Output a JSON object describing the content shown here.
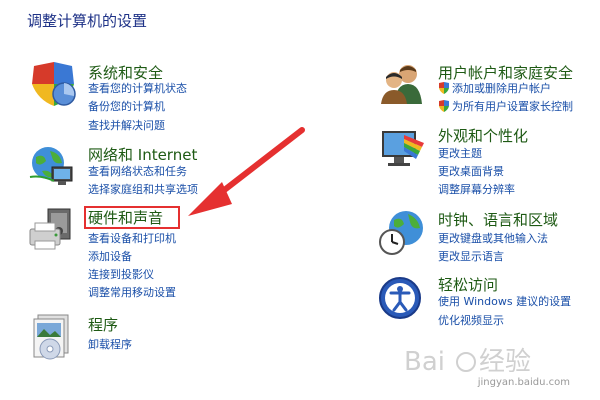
{
  "page": {
    "title": "调整计算机的设置"
  },
  "categories": {
    "system_security": {
      "heading": "系统和安全",
      "links": [
        "查看您的计算机状态",
        "备份您的计算机",
        "查找并解决问题"
      ]
    },
    "network": {
      "heading": "网络和 Internet",
      "links": [
        "查看网络状态和任务",
        "选择家庭组和共享选项"
      ]
    },
    "hardware_sound": {
      "heading": "硬件和声音",
      "links": [
        "查看设备和打印机",
        "添加设备",
        "连接到投影仪",
        "调整常用移动设置"
      ]
    },
    "programs": {
      "heading": "程序",
      "links": [
        "卸载程序"
      ]
    },
    "user_accounts": {
      "heading": "用户帐户和家庭安全",
      "links": [
        "添加或删除用户帐户",
        "为所有用户设置家长控制"
      ]
    },
    "appearance": {
      "heading": "外观和个性化",
      "links": [
        "更改主题",
        "更改桌面背景",
        "调整屏幕分辨率"
      ]
    },
    "clock_region": {
      "heading": "时钟、语言和区域",
      "links": [
        "更改键盘或其他输入法",
        "更改显示语言"
      ]
    },
    "ease_access": {
      "heading": "轻松访问",
      "links": [
        "使用 Windows 建议的设置",
        "优化视频显示"
      ]
    }
  },
  "watermark": {
    "text": "jingyan.baidu.com"
  },
  "colors": {
    "heading": "#1e5a14",
    "link": "#1a4fa8",
    "title": "#1e3287",
    "annotation": "#e53030"
  },
  "icons": {
    "system_security": "shield-icon",
    "network": "globe-network-icon",
    "hardware_sound": "printer-icon",
    "programs": "programs-icon",
    "user_accounts": "users-icon",
    "appearance": "appearance-icon",
    "clock_region": "clock-globe-icon",
    "ease_access": "ease-access-icon"
  }
}
